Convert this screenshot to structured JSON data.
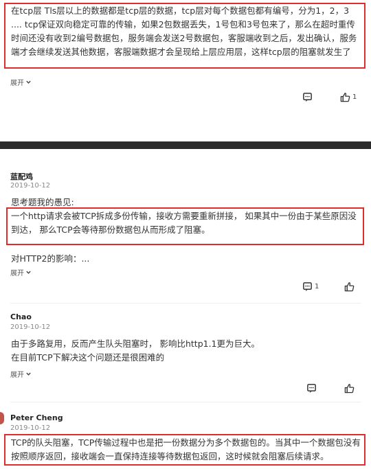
{
  "comments": [
    {
      "text": "在tcp层 Tls层以上的数据都是tcp层的数据，tcp层对每个数据包都有编号，分为1，2，3 .... tcp保证双向稳定可靠的传输，如果2包数据丢失，1号包和3号包来了，那么在超时重传时间还没有收到2编号数据包，服务端会发送2号数据包，客服端收到之后，发出确认，服务端才会继续发送其他数据，客服端数据才会呈现给上层应用层，这样tcp层的阻塞就发生了",
      "expand": "展开",
      "like_count": "1"
    },
    {
      "author": "蓝配鸡",
      "date": "2019-10-12",
      "intro": "思考题我的愚见:",
      "highlight": "一个http请求会被TCP拆成多份传输，接收方需要重新拼接， 如果其中一份由于某些原因没到达， 那么TCP会等待那份数据包从而形成了阻塞。",
      "extra": "对HTTP2的影响：...",
      "expand": "展开",
      "reply_count": "1"
    },
    {
      "author": "Chao",
      "date": "2019-10-12",
      "line1": "由于多路复用，反而产生队头阻塞时， 影响比http1.1更为巨大。",
      "line2": "在目前TCP下解决这个问题还是很困难的",
      "expand": "展开"
    },
    {
      "author": "Peter Cheng",
      "date": "2019-10-12",
      "highlight": "TCP的队头阻塞，TCP传输过程中也是把一份数据分为多个数据包的。当其中一个数据包没有按照顺序返回，接收端会一直保持连接等待数据包返回，这时候就会阻塞后续请求。"
    }
  ],
  "icons": {
    "reply": "comment-icon",
    "like": "thumbs-up-icon",
    "expand": "chevron-down-icon"
  },
  "colors": {
    "highlight_border": "#e02b2b",
    "divider": "#2b2b2b"
  }
}
